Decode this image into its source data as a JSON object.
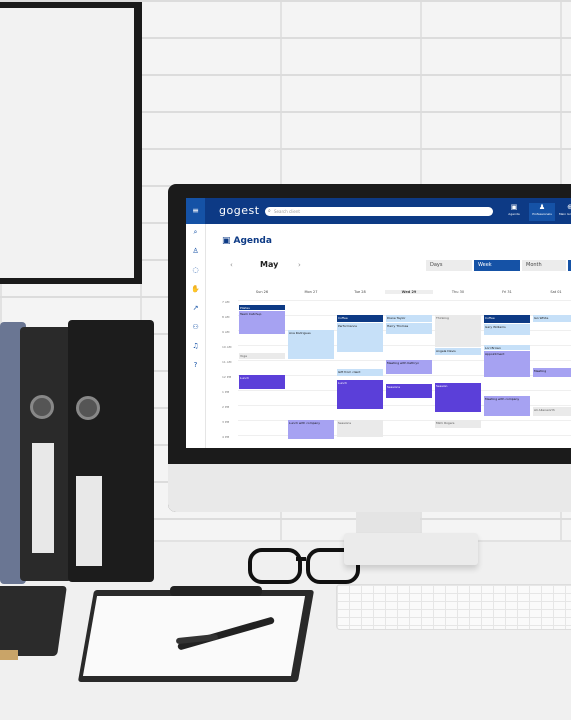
{
  "app": {
    "logo_main": "go",
    "logo_rest": "gest",
    "search_placeholder": "Search client",
    "menu_icon": "menu-icon",
    "nav": [
      {
        "label": "Agenda",
        "icon": "calendar-icon",
        "glyph": "▣"
      },
      {
        "label": "Professionals",
        "icon": "users-icon",
        "glyph": "♟"
      },
      {
        "label": "Main language",
        "icon": "globe-icon",
        "glyph": "⊕"
      }
    ],
    "sidebar_icons": [
      {
        "name": "search-icon",
        "glyph": "⌕"
      },
      {
        "name": "person-icon",
        "glyph": "♙"
      },
      {
        "name": "chat-icon",
        "glyph": "◌"
      },
      {
        "name": "hand-icon",
        "glyph": "✋"
      },
      {
        "name": "chart-icon",
        "glyph": "↗"
      },
      {
        "name": "team-icon",
        "glyph": "⚇"
      },
      {
        "name": "stats-icon",
        "glyph": "♫"
      },
      {
        "name": "help-icon",
        "glyph": "?"
      }
    ]
  },
  "page": {
    "title": "Agenda",
    "month": "May",
    "prev_glyph": "‹",
    "next_glyph": "›",
    "views": [
      "Days",
      "Week",
      "Month"
    ],
    "active_view": "Week"
  },
  "calendar": {
    "days": [
      "Sun 26",
      "Mon 27",
      "Tue 28",
      "Wed 29",
      "Thu 30",
      "Fri 31",
      "Sat 01"
    ],
    "today_index": 3,
    "times": [
      "7 AM",
      "8 AM",
      "9 AM",
      "10 AM",
      "11 AM",
      "12 PM",
      "1 PM",
      "2 PM",
      "3 PM",
      "4 PM"
    ],
    "events": [
      {
        "day": 0,
        "start": 0.3,
        "dur": 0.4,
        "color": "navy",
        "text": "Pilates"
      },
      {
        "day": 0,
        "start": 0.7,
        "dur": 1.6,
        "color": "violet",
        "text": "Team Catchup"
      },
      {
        "day": 0,
        "start": 3.5,
        "dur": 0.5,
        "color": "grey",
        "text": "Yoga"
      },
      {
        "day": 0,
        "start": 5.0,
        "dur": 1.0,
        "color": "deep",
        "text": "Lunch"
      },
      {
        "day": 1,
        "start": 2.0,
        "dur": 2.0,
        "color": "light",
        "text": "Ana Rodrigues"
      },
      {
        "day": 1,
        "start": 8.0,
        "dur": 1.3,
        "color": "violet",
        "text": "Lunch with company"
      },
      {
        "day": 2,
        "start": 1.0,
        "dur": 0.5,
        "color": "navy",
        "text": "Coffee"
      },
      {
        "day": 2,
        "start": 1.5,
        "dur": 2.0,
        "color": "light",
        "text": "Performance"
      },
      {
        "day": 2,
        "start": 4.6,
        "dur": 0.5,
        "color": "light",
        "text": "Gift from client"
      },
      {
        "day": 2,
        "start": 5.3,
        "dur": 2.0,
        "color": "deep",
        "text": "Lunch"
      },
      {
        "day": 2,
        "start": 8.0,
        "dur": 1.2,
        "color": "grey",
        "text": "Sessions"
      },
      {
        "day": 3,
        "start": 1.0,
        "dur": 0.5,
        "color": "light",
        "text": "Diane Taylor"
      },
      {
        "day": 3,
        "start": 1.5,
        "dur": 0.8,
        "color": "light",
        "text": "Harry Thomas"
      },
      {
        "day": 3,
        "start": 4.0,
        "dur": 1.0,
        "color": "violet",
        "text": "Meeting with Kathryn"
      },
      {
        "day": 3,
        "start": 5.6,
        "dur": 1.0,
        "color": "deep",
        "text": "Sessions"
      },
      {
        "day": 4,
        "start": 1.0,
        "dur": 2.2,
        "color": "grey",
        "text": "Thinking"
      },
      {
        "day": 4,
        "start": 3.2,
        "dur": 0.5,
        "color": "light",
        "text": "Angela Davis"
      },
      {
        "day": 4,
        "start": 5.5,
        "dur": 2.0,
        "color": "deep",
        "text": "Session"
      },
      {
        "day": 4,
        "start": 8.0,
        "dur": 0.6,
        "color": "grey",
        "text": "Mimi Rogers"
      },
      {
        "day": 5,
        "start": 1.0,
        "dur": 0.6,
        "color": "navy",
        "text": "Coffee"
      },
      {
        "day": 5,
        "start": 1.6,
        "dur": 0.8,
        "color": "light",
        "text": "Gary Williams"
      },
      {
        "day": 5,
        "start": 3.0,
        "dur": 0.4,
        "color": "light",
        "text": "Lori Brown"
      },
      {
        "day": 5,
        "start": 3.4,
        "dur": 1.8,
        "color": "violet",
        "text": "Appointment"
      },
      {
        "day": 5,
        "start": 6.4,
        "dur": 1.4,
        "color": "violet",
        "text": "Meeting with company"
      },
      {
        "day": 6,
        "start": 1.0,
        "dur": 0.5,
        "color": "light",
        "text": "Ian White"
      },
      {
        "day": 6,
        "start": 4.5,
        "dur": 0.7,
        "color": "violet",
        "text": "Meeting"
      },
      {
        "day": 6,
        "start": 7.1,
        "dur": 0.7,
        "color": "grey",
        "text": "Ali Allenworth"
      }
    ]
  },
  "colors": {
    "brand_dark": "#0d3a85",
    "brand": "#1552a6",
    "violet": "#a6a2f2",
    "deep": "#5b3fd9",
    "light": "#c6e0f8"
  }
}
